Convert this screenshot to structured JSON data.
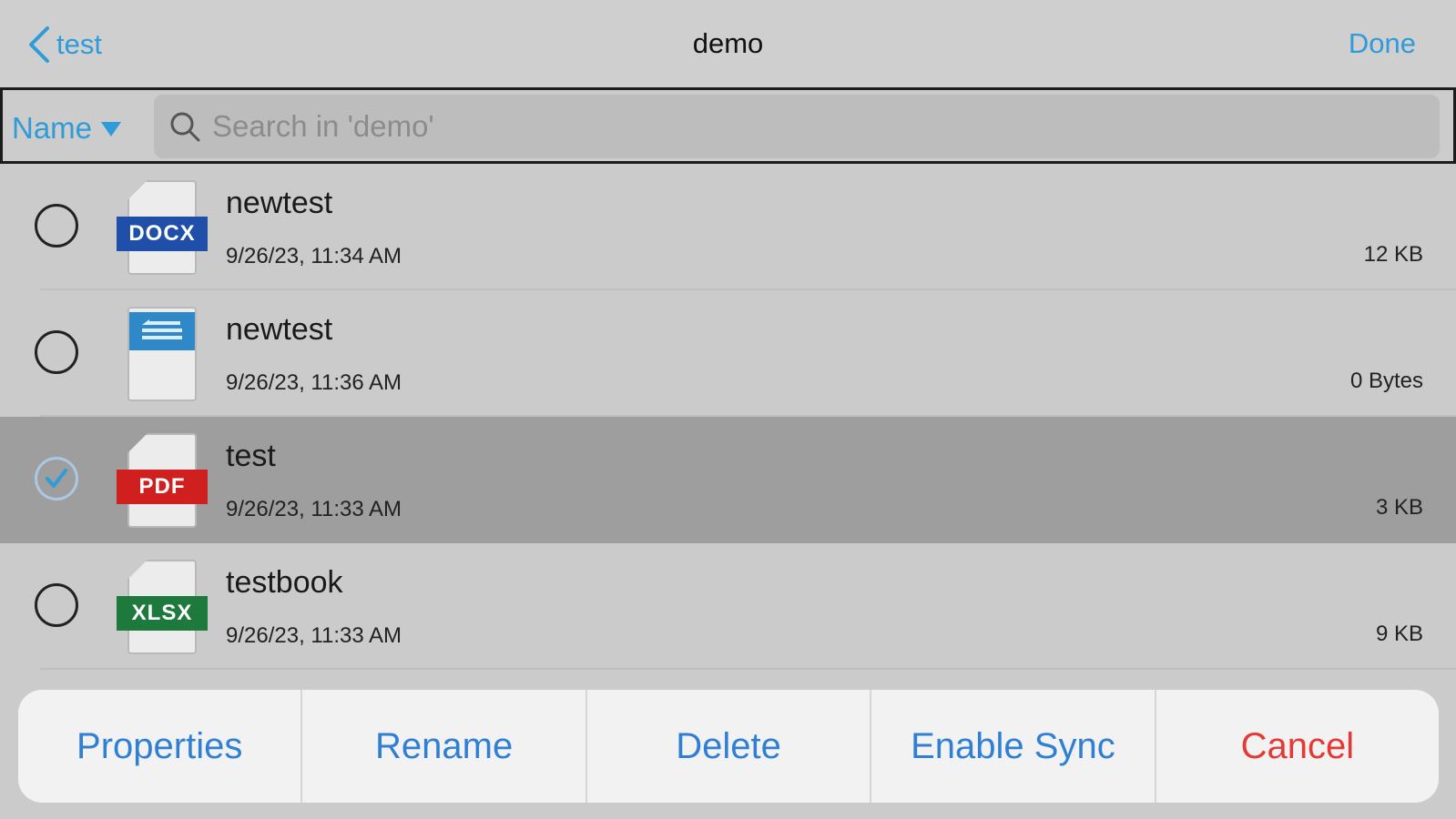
{
  "navbar": {
    "back_label": "test",
    "title": "demo",
    "done_label": "Done"
  },
  "toolbar": {
    "sort_label": "Name",
    "search_placeholder": "Search in 'demo'"
  },
  "files": [
    {
      "name": "newtest",
      "date": "9/26/23, 11:34 AM",
      "size": "12 KB",
      "type": "DOCX",
      "selected": false
    },
    {
      "name": "newtest",
      "date": "9/26/23, 11:36 AM",
      "size": "0 Bytes",
      "type": "document",
      "selected": false
    },
    {
      "name": "test",
      "date": "9/26/23, 11:33 AM",
      "size": "3 KB",
      "type": "PDF",
      "selected": true
    },
    {
      "name": "testbook",
      "date": "9/26/23, 11:33 AM",
      "size": "9 KB",
      "type": "XLSX",
      "selected": false
    }
  ],
  "badges": {
    "docx": "DOCX",
    "pdf": "PDF",
    "xlsx": "XLSX"
  },
  "actions": {
    "properties": "Properties",
    "rename": "Rename",
    "delete": "Delete",
    "enable_sync": "Enable Sync",
    "cancel": "Cancel"
  },
  "colors": {
    "accent": "#2f9bd8",
    "destructive": "#e53935",
    "docx_badge": "#1f4fa8",
    "pdf_badge": "#d01f1f",
    "xlsx_badge": "#1e7a3c"
  },
  "icons": {
    "back": "chevron-left-icon",
    "sort": "triangle-down-icon",
    "search": "search-icon",
    "check": "checkmark-icon"
  }
}
